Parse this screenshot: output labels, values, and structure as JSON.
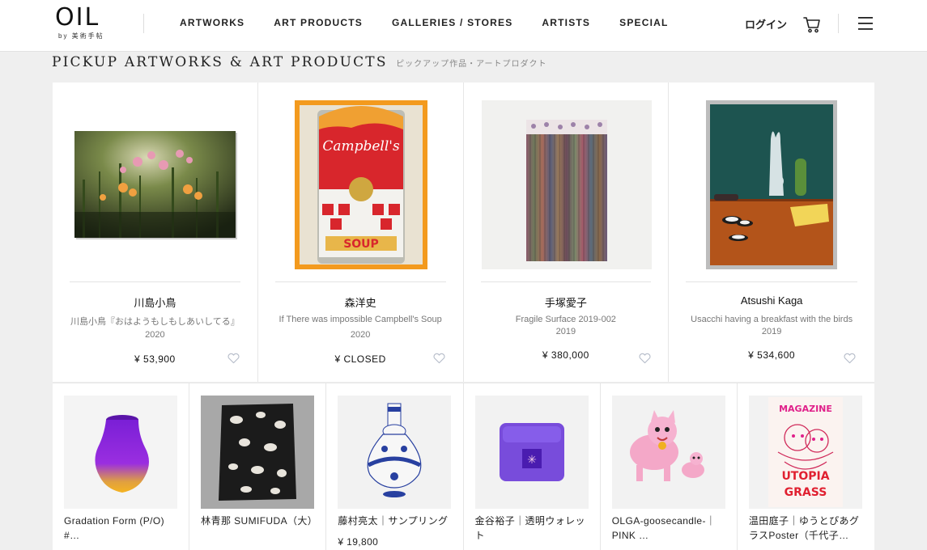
{
  "header": {
    "logo": "OIL",
    "logo_sub": "by 美術手帖",
    "nav": [
      "ARTWORKS",
      "ART PRODUCTS",
      "GALLERIES / STORES",
      "ARTISTS",
      "SPECIAL"
    ],
    "login": "ログイン",
    "icons": [
      "cart-icon",
      "hamburger-menu-icon"
    ]
  },
  "section": {
    "title_en": "PICKUP ARTWORKS & ART PRODUCTS",
    "title_ja": "ピックアップ作品・アートプロダクト"
  },
  "top_cards": [
    {
      "artist": "川島小鳥",
      "work": "川島小鳥『おはようもしもしあいしてる』",
      "year": "2020",
      "price": "¥ 53,900"
    },
    {
      "artist": "森洋史",
      "work": "If There was impossible Campbell's Soup",
      "year": "2020",
      "price": "¥ CLOSED"
    },
    {
      "artist": "手塚愛子",
      "work": "Fragile Surface 2019-002",
      "year": "2019",
      "price": "¥ 380,000"
    },
    {
      "artist": "Atsushi Kaga",
      "work": "Usacchi having a breakfast with the birds",
      "year": "2019",
      "price": "¥ 534,600"
    }
  ],
  "bottom_cards": [
    {
      "title": "Gradation Form (P/O) #…",
      "price": ""
    },
    {
      "title": "林青那 SUMIFUDA（大）",
      "price": ""
    },
    {
      "title": "藤村亮太｜サンプリング",
      "price": "¥ 19,800"
    },
    {
      "title": "金谷裕子｜透明ウォレット",
      "price": ""
    },
    {
      "title": "OLGA-goosecandle-｜PINK …",
      "price": ""
    },
    {
      "title": "温田庭子｜ゆうとぴあグラスPoster（千代子…",
      "price": ""
    }
  ],
  "colors": {
    "background": "#efefef",
    "card": "#ffffff",
    "heart": "#b5bcc9"
  }
}
